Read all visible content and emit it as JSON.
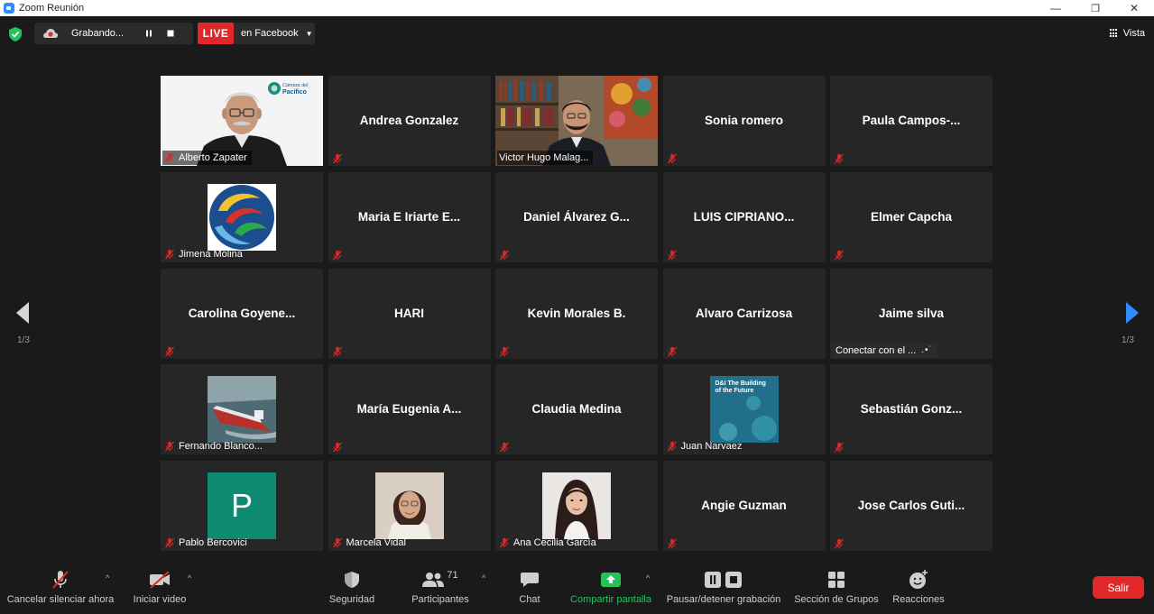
{
  "window": {
    "title": "Zoom Reunión",
    "minimize": "—",
    "restore": "❐",
    "close": "✕"
  },
  "topbar": {
    "recording_text": "Grabando...",
    "live_badge": "LIVE",
    "live_destination": "en Facebook",
    "view_label": "Vista"
  },
  "navigation": {
    "prev_page": "1/3",
    "next_page": "1/3"
  },
  "participants": [
    {
      "name": "Alberto Zapater",
      "kind": "video-alberto",
      "muted": true
    },
    {
      "name": "Andrea Gonzalez",
      "kind": "name",
      "muted": true
    },
    {
      "name": "Victor Hugo Malag...",
      "kind": "video-victor",
      "muted": false,
      "active_speaker": true
    },
    {
      "name": "Sonia romero",
      "kind": "name",
      "muted": true
    },
    {
      "name": "Paula  Campos-...",
      "kind": "name",
      "muted": true
    },
    {
      "name": "Jimena Molina",
      "kind": "avatar-logo",
      "muted": true
    },
    {
      "name": "Maria  E  Iriarte  E...",
      "kind": "name",
      "muted": true
    },
    {
      "name": "Daniel  Álvarez  G...",
      "kind": "name",
      "muted": true
    },
    {
      "name": "LUIS  CIPRIANO...",
      "kind": "name",
      "muted": true
    },
    {
      "name": "Elmer Capcha",
      "kind": "name",
      "muted": true
    },
    {
      "name": "Carolina  Goyene...",
      "kind": "name",
      "muted": true
    },
    {
      "name": "HARI",
      "kind": "name",
      "muted": true
    },
    {
      "name": "Kevin Morales B.",
      "kind": "name",
      "muted": true
    },
    {
      "name": "Alvaro Carrizosa",
      "kind": "name",
      "muted": true
    },
    {
      "name": "Jaime silva",
      "kind": "name",
      "muted": false,
      "status": "Conectar con el ..."
    },
    {
      "name": "Fernando Blanco...",
      "kind": "avatar-ship",
      "muted": true
    },
    {
      "name": "María  Eugenia  A...",
      "kind": "name",
      "muted": true
    },
    {
      "name": "Claudia Medina",
      "kind": "name",
      "muted": true
    },
    {
      "name": "Juan Narvaez",
      "kind": "avatar-book",
      "muted": true,
      "avatar_text": "D&I The Building of the Future"
    },
    {
      "name": "Sebastián  Gonz...",
      "kind": "name",
      "muted": true
    },
    {
      "name": "Pablo Bercovici",
      "kind": "avatar-letter",
      "muted": true,
      "avatar_letter": "P"
    },
    {
      "name": "Marcela Vidal",
      "kind": "avatar-photo-marcela",
      "muted": true
    },
    {
      "name": "Ana Cecilia García",
      "kind": "avatar-photo-ana",
      "muted": true
    },
    {
      "name": "Angie Guzman",
      "kind": "name",
      "muted": true
    },
    {
      "name": "Jose  Carlos  Guti...",
      "kind": "name",
      "muted": true
    }
  ],
  "video_overlays": {
    "logo_text": "Cámara del Pacífico"
  },
  "toolbar": {
    "mute_label": "Cancelar silenciar ahora",
    "video_label": "Iniciar video",
    "security_label": "Seguridad",
    "participants_label": "Participantes",
    "participants_count": "71",
    "chat_label": "Chat",
    "share_label": "Compartir pantalla",
    "record_label": "Pausar/detener grabación",
    "breakout_label": "Sección de Grupos",
    "reactions_label": "Reacciones",
    "leave_label": "Salir"
  },
  "colors": {
    "active_border": "#d8e83a",
    "live_red": "#e02828",
    "share_green": "#23c35a",
    "tile_bg": "#262626"
  }
}
